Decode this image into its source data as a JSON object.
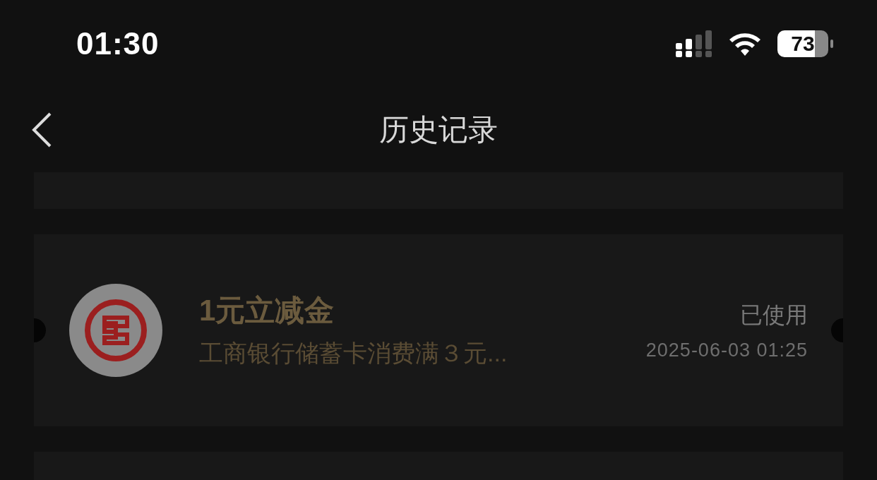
{
  "status_bar": {
    "time": "01:30",
    "battery": "73"
  },
  "nav": {
    "title": "历史记录"
  },
  "coupons": [
    {
      "title": "1元立减金",
      "description": "工商银行储蓄卡消费满３元...",
      "status": "已使用",
      "time": "2025-06-03 01:25",
      "used": true
    }
  ]
}
